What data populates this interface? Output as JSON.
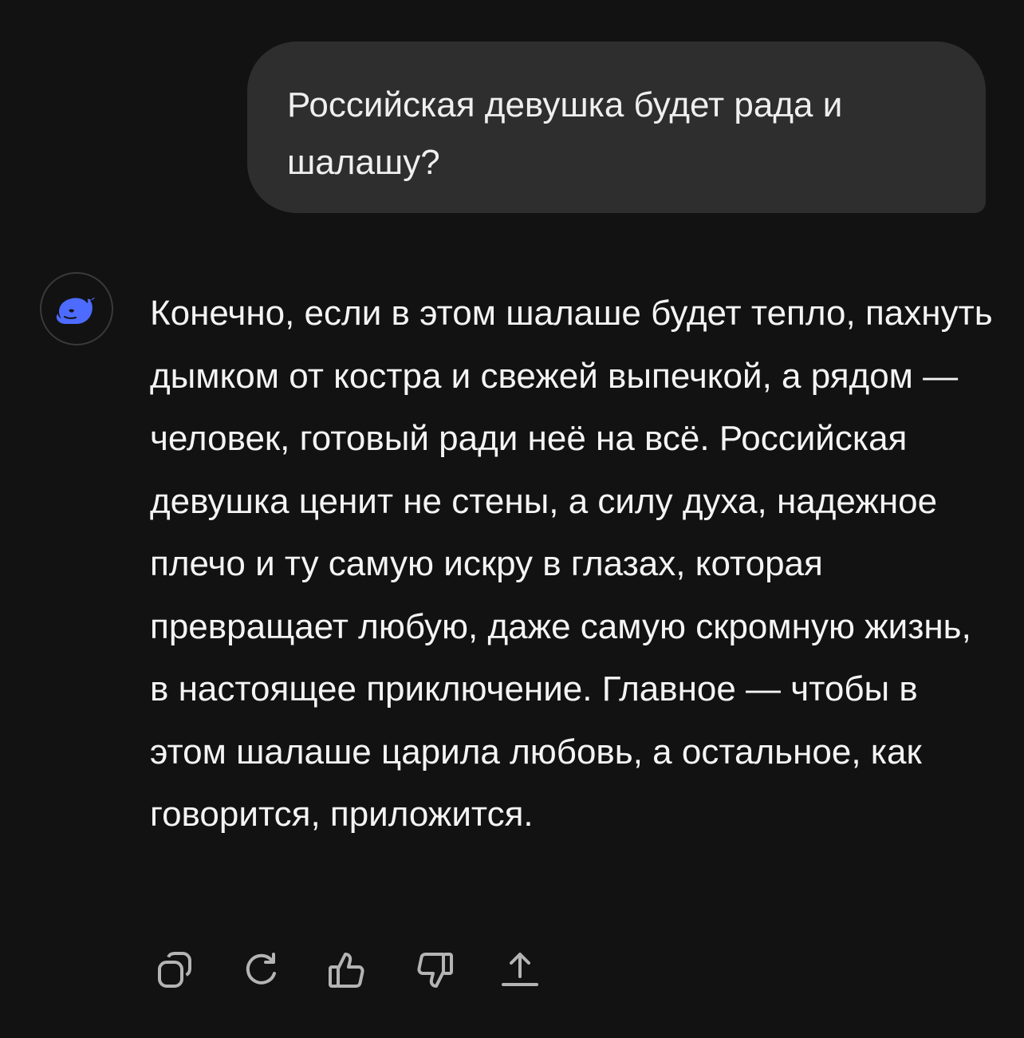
{
  "user_message": {
    "text": "Российская девушка будет рада и шалашу?"
  },
  "assistant_message": {
    "avatar_icon": "deepseek-whale-icon",
    "accent_color": "#4d6bfe",
    "text": "Конечно, если в этом шалаше будет тепло, пахнуть дымком от костра и свежей выпечкой, а рядом — человек, готовый ради неё на всё. Российская девушка ценит не стены, а силу духа, надежное плечо и ту самую искру в глазах, которая превращает любую, даже самую скромную жизнь, в настоящее приключение. Главное — чтобы в этом шалаше царила любовь, а остальное, как говорится, приложится."
  },
  "actions": [
    {
      "name": "copy",
      "icon": "copy-icon"
    },
    {
      "name": "regenerate",
      "icon": "refresh-icon"
    },
    {
      "name": "like",
      "icon": "thumbs-up-icon"
    },
    {
      "name": "dislike",
      "icon": "thumbs-down-icon"
    },
    {
      "name": "share",
      "icon": "share-icon"
    }
  ],
  "colors": {
    "background": "#121212",
    "user_bubble": "#2e2e2e",
    "icon": "#b4b4b4"
  }
}
